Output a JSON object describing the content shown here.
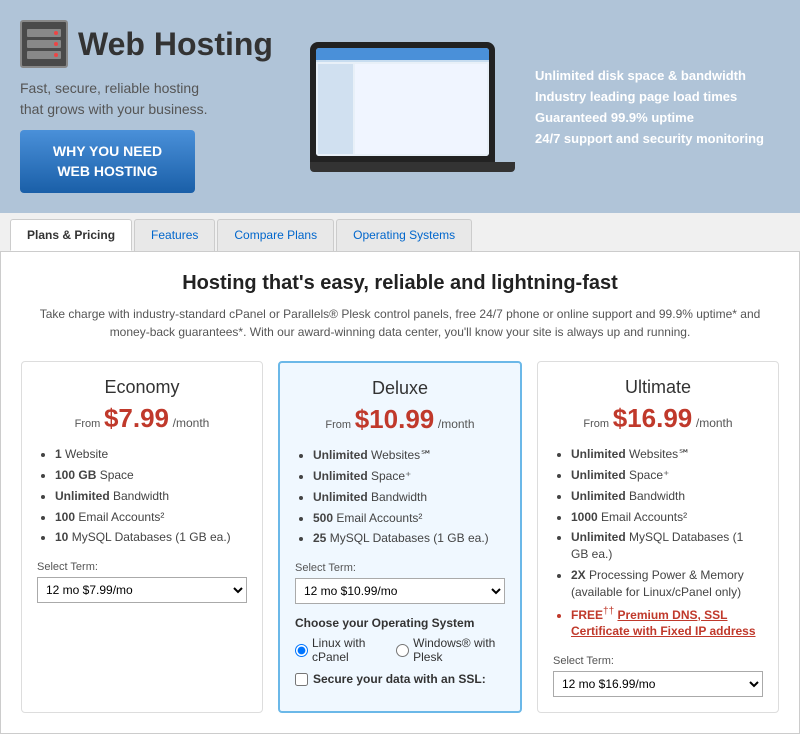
{
  "header": {
    "logo_text": "Web Hosting",
    "tagline_line1": "Fast, secure, reliable hosting",
    "tagline_line2": "that grows with your business.",
    "why_btn_line1": "WHY YOU NEED",
    "why_btn_line2": "WEB HOSTING",
    "features": [
      "Unlimited disk space & bandwidth",
      "Industry leading page load times",
      "Guaranteed 99.9% uptime",
      "24/7 support and security monitoring"
    ]
  },
  "tabs": [
    {
      "label": "Plans & Pricing",
      "active": true
    },
    {
      "label": "Features",
      "active": false
    },
    {
      "label": "Compare Plans",
      "active": false
    },
    {
      "label": "Operating Systems",
      "active": false
    }
  ],
  "main": {
    "title": "Hosting that's easy, reliable and lightning-fast",
    "description": "Take charge with industry-standard cPanel or Parallels® Plesk control panels, free 24/7 phone or online support and 99.9% uptime* and money-back guarantees*. With our award-winning data center, you'll know your site is always up and running."
  },
  "plans": [
    {
      "id": "economy",
      "name": "Economy",
      "from": "From",
      "price": "$7.99",
      "per": "/month",
      "features": [
        {
          "bold": "1",
          "text": " Website"
        },
        {
          "bold": "100 GB",
          "text": " Space"
        },
        {
          "bold": "Unlimited",
          "text": " Bandwidth"
        },
        {
          "bold": "100",
          "text": " Email Accounts²"
        },
        {
          "bold": "10",
          "text": " MySQL Databases (1 GB ea.)"
        }
      ],
      "select_label": "Select Term:",
      "select_value": "12 mo     $7.99/mo"
    },
    {
      "id": "deluxe",
      "name": "Deluxe",
      "from": "From",
      "price": "$10.99",
      "per": "/month",
      "featured": true,
      "features": [
        {
          "bold": "Unlimited",
          "text": " Websites℠"
        },
        {
          "bold": "Unlimited",
          "text": " Space⁺"
        },
        {
          "bold": "Unlimited",
          "text": " Bandwidth"
        },
        {
          "bold": "500",
          "text": " Email Accounts²"
        },
        {
          "bold": "25",
          "text": " MySQL Databases (1 GB ea.)"
        }
      ],
      "select_label": "Select Term:",
      "select_value": "12 mo     $10.99/mo",
      "os_label": "Choose your Operating System",
      "os_options": [
        "Linux with cPanel",
        "Windows® with Plesk"
      ],
      "ssl_label": "Secure your data with an SSL:"
    },
    {
      "id": "ultimate",
      "name": "Ultimate",
      "from": "From",
      "price": "$16.99",
      "per": "/month",
      "features": [
        {
          "bold": "Unlimited",
          "text": " Websites℠"
        },
        {
          "bold": "Unlimited",
          "text": " Space⁺"
        },
        {
          "bold": "Unlimited",
          "text": " Bandwidth"
        },
        {
          "bold": "1000",
          "text": " Email Accounts²"
        },
        {
          "bold": "Unlimited",
          "text": " MySQL Databases (1 GB ea.)"
        },
        {
          "bold": "2X",
          "text": " Processing Power & Memory (available for Linux/cPanel only)",
          "normal": true
        },
        {
          "bold": "FREE",
          "text": "†† Premium DNS, SSL Certificate with Fixed IP address",
          "red": true
        }
      ],
      "select_label": "Select Term:",
      "select_value": "12 mo     $16.99/mo"
    }
  ]
}
